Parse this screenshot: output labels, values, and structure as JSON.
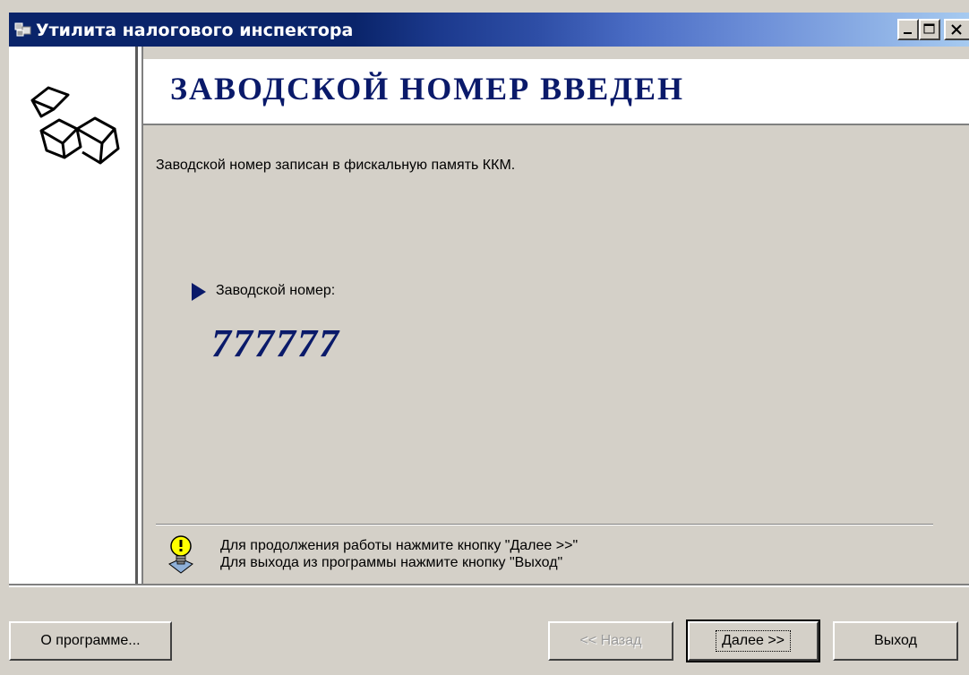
{
  "window": {
    "title": "Утилита налогового инспектора"
  },
  "header": {
    "title": "ЗАВОДСКОЙ  НОМЕР  ВВЕДЕН"
  },
  "main": {
    "info_text": "Заводской номер  записан в фискальную память ККМ.",
    "serial_label": "Заводской номер:",
    "serial_value": "777777"
  },
  "hint": {
    "line1": "Для продолжения работы  нажмите кнопку \"Далее >>\"",
    "line2": "Для выхода из программы нажмите кнопку \"Выход\""
  },
  "buttons": {
    "about": "О программе...",
    "back": "<< Назад",
    "next": "Далее >>",
    "exit": "Выход"
  },
  "colors": {
    "accent": "#0a1a6a",
    "face": "#d4d0c8"
  },
  "icons": {
    "app": "app-icon",
    "logo": "cubes-logo-icon",
    "hint": "lightbulb-icon",
    "pointer": "triangle-pointer-icon"
  }
}
